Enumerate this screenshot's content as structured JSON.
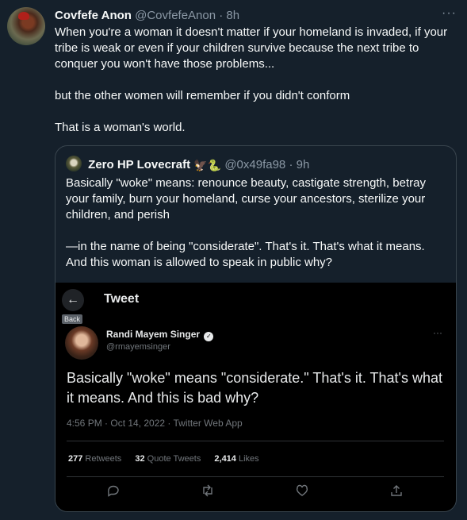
{
  "tweet": {
    "author_name": "Covfefe Anon",
    "author_handle": "@CovfefeAnon",
    "time": "· 8h",
    "more": "···",
    "paragraphs": [
      "When you're a woman it doesn't matter if your homeland is invaded, if your tribe is weak or even if your children survive because the next tribe to conquer you won't have those problems...",
      "but the other women will remember if you didn't conform",
      "That is a woman's world."
    ]
  },
  "quoted": {
    "author_name": "Zero HP Lovecraft",
    "emoji": "🦅🐍",
    "author_handle": "@0x49fa98",
    "time": "· 9h",
    "paragraphs": [
      "Basically \"woke\" means: renounce beauty, castigate strength, betray your family, burn your homeland, curse your ancestors, sterilize your children,  and perish",
      "—in the name of being \"considerate\". That's it. That's what it means. And this woman is allowed to speak in public why?"
    ]
  },
  "media": {
    "back_icon": "←",
    "back_tooltip": "Back",
    "title": "Tweet",
    "author_name": "Randi Mayem Singer",
    "verified_icon": "✓",
    "author_handle": "@rmayemsinger",
    "more": "···",
    "text": "Basically \"woke\" means \"considerate.\" That's it. That's what it means. And this is bad why?",
    "timestamp": "4:56 PM · Oct 14, 2022 · Twitter Web App",
    "stats": {
      "retweets_count": "277",
      "retweets_label": "Retweets",
      "quotes_count": "32",
      "quotes_label": "Quote Tweets",
      "likes_count": "2,414",
      "likes_label": "Likes"
    },
    "actions": {
      "reply_icon": "💬︎",
      "retweet_icon": "⟲",
      "like_icon": "♡",
      "share_icon": "⇧"
    }
  }
}
